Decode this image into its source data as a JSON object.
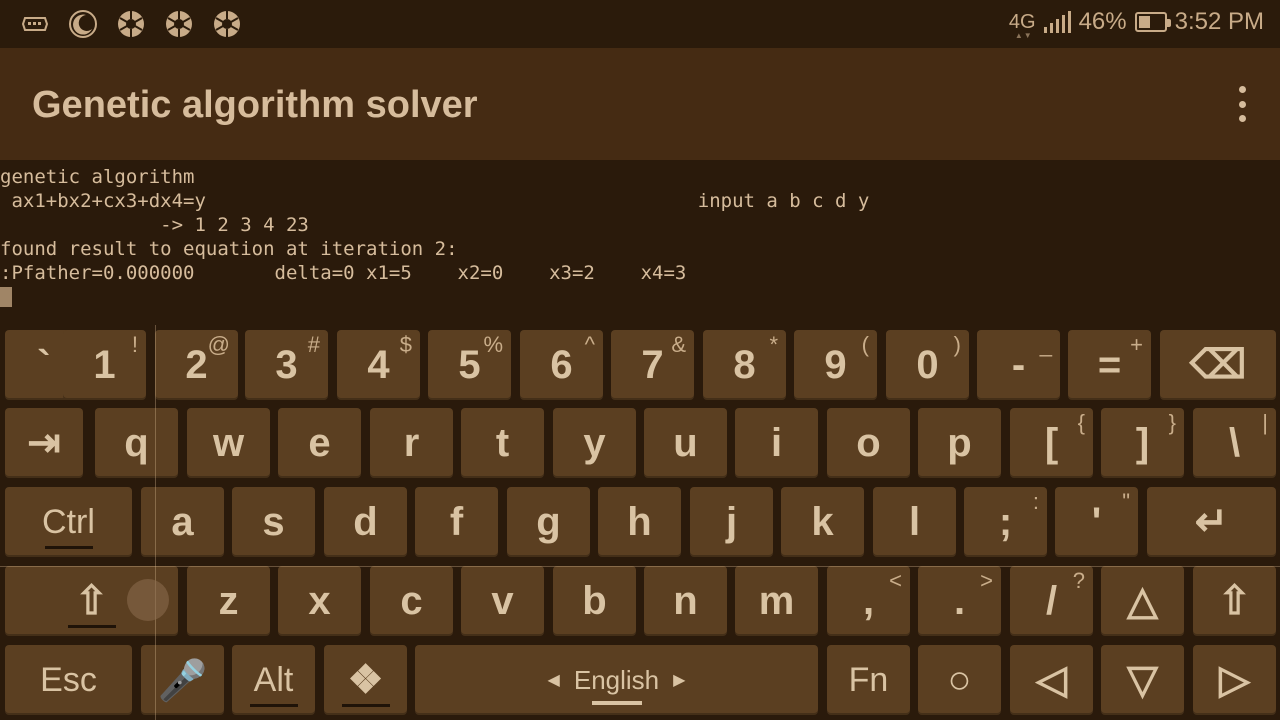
{
  "status_bar": {
    "network": "4G",
    "battery_percent": "46%",
    "battery_level": 0.46,
    "time": "3:52 PM",
    "left_icons": [
      "keyboard-icon",
      "moon-icon",
      "aperture-icon",
      "aperture-icon",
      "aperture-icon"
    ]
  },
  "app_bar": {
    "title": "Genetic algorithm solver",
    "menu_icon": "overflow-menu-icon"
  },
  "terminal": {
    "lines": [
      "genetic algorithm",
      " ax1+bx2+cx3+dx4=y                                           input a b c d y",
      "              -> 1 2 3 4 23",
      "found result to equation at iteration 2:",
      ":Pfather=0.000000       delta=0 x1=5    x2=0    x3=2    x4=3"
    ]
  },
  "keyboard": {
    "row1": [
      {
        "main": "`",
        "sec": "~"
      },
      {
        "main": "1",
        "sec": "!"
      },
      {
        "main": "2",
        "sec": "@"
      },
      {
        "main": "3",
        "sec": "#"
      },
      {
        "main": "4",
        "sec": "$"
      },
      {
        "main": "5",
        "sec": "%"
      },
      {
        "main": "6",
        "sec": "^"
      },
      {
        "main": "7",
        "sec": "&"
      },
      {
        "main": "8",
        "sec": "*"
      },
      {
        "main": "9",
        "sec": "("
      },
      {
        "main": "0",
        "sec": ")"
      },
      {
        "main": "-",
        "sec": "_"
      },
      {
        "main": "=",
        "sec": "+"
      },
      {
        "main": "⌫",
        "sec": ""
      }
    ],
    "row2": [
      {
        "main": "⇥",
        "sec": ""
      },
      {
        "main": "q",
        "sec": ""
      },
      {
        "main": "w",
        "sec": ""
      },
      {
        "main": "e",
        "sec": ""
      },
      {
        "main": "r",
        "sec": ""
      },
      {
        "main": "t",
        "sec": ""
      },
      {
        "main": "y",
        "sec": ""
      },
      {
        "main": "u",
        "sec": ""
      },
      {
        "main": "i",
        "sec": ""
      },
      {
        "main": "o",
        "sec": ""
      },
      {
        "main": "p",
        "sec": ""
      },
      {
        "main": "[",
        "sec": "{"
      },
      {
        "main": "]",
        "sec": "}"
      },
      {
        "main": "\\",
        "sec": "|"
      }
    ],
    "row3": [
      {
        "main": "Ctrl",
        "sec": ""
      },
      {
        "main": "a",
        "sec": ""
      },
      {
        "main": "s",
        "sec": ""
      },
      {
        "main": "d",
        "sec": ""
      },
      {
        "main": "f",
        "sec": ""
      },
      {
        "main": "g",
        "sec": ""
      },
      {
        "main": "h",
        "sec": ""
      },
      {
        "main": "j",
        "sec": ""
      },
      {
        "main": "k",
        "sec": ""
      },
      {
        "main": "l",
        "sec": ""
      },
      {
        "main": ";",
        "sec": ":"
      },
      {
        "main": "'",
        "sec": "\""
      },
      {
        "main": "↵",
        "sec": ""
      }
    ],
    "row4": [
      {
        "main": "⇧",
        "sec": ""
      },
      {
        "main": "z",
        "sec": ""
      },
      {
        "main": "x",
        "sec": ""
      },
      {
        "main": "c",
        "sec": ""
      },
      {
        "main": "v",
        "sec": ""
      },
      {
        "main": "b",
        "sec": ""
      },
      {
        "main": "n",
        "sec": ""
      },
      {
        "main": "m",
        "sec": ""
      },
      {
        "main": ",",
        "sec": "<"
      },
      {
        "main": ".",
        "sec": ">"
      },
      {
        "main": "/",
        "sec": "?"
      },
      {
        "main": "△",
        "sec": ""
      },
      {
        "main": "⇧",
        "sec": ""
      }
    ],
    "row5": [
      {
        "main": "Esc",
        "sec": ""
      },
      {
        "main": "🎤",
        "sec": ""
      },
      {
        "main": "Alt",
        "sec": ""
      },
      {
        "main": "❖",
        "sec": ""
      },
      {
        "main": "English",
        "sec": ""
      },
      {
        "main": "Fn",
        "sec": ""
      },
      {
        "main": "○",
        "sec": ""
      },
      {
        "main": "◁",
        "sec": ""
      },
      {
        "main": "▽",
        "sec": ""
      },
      {
        "main": "▷",
        "sec": ""
      }
    ]
  }
}
